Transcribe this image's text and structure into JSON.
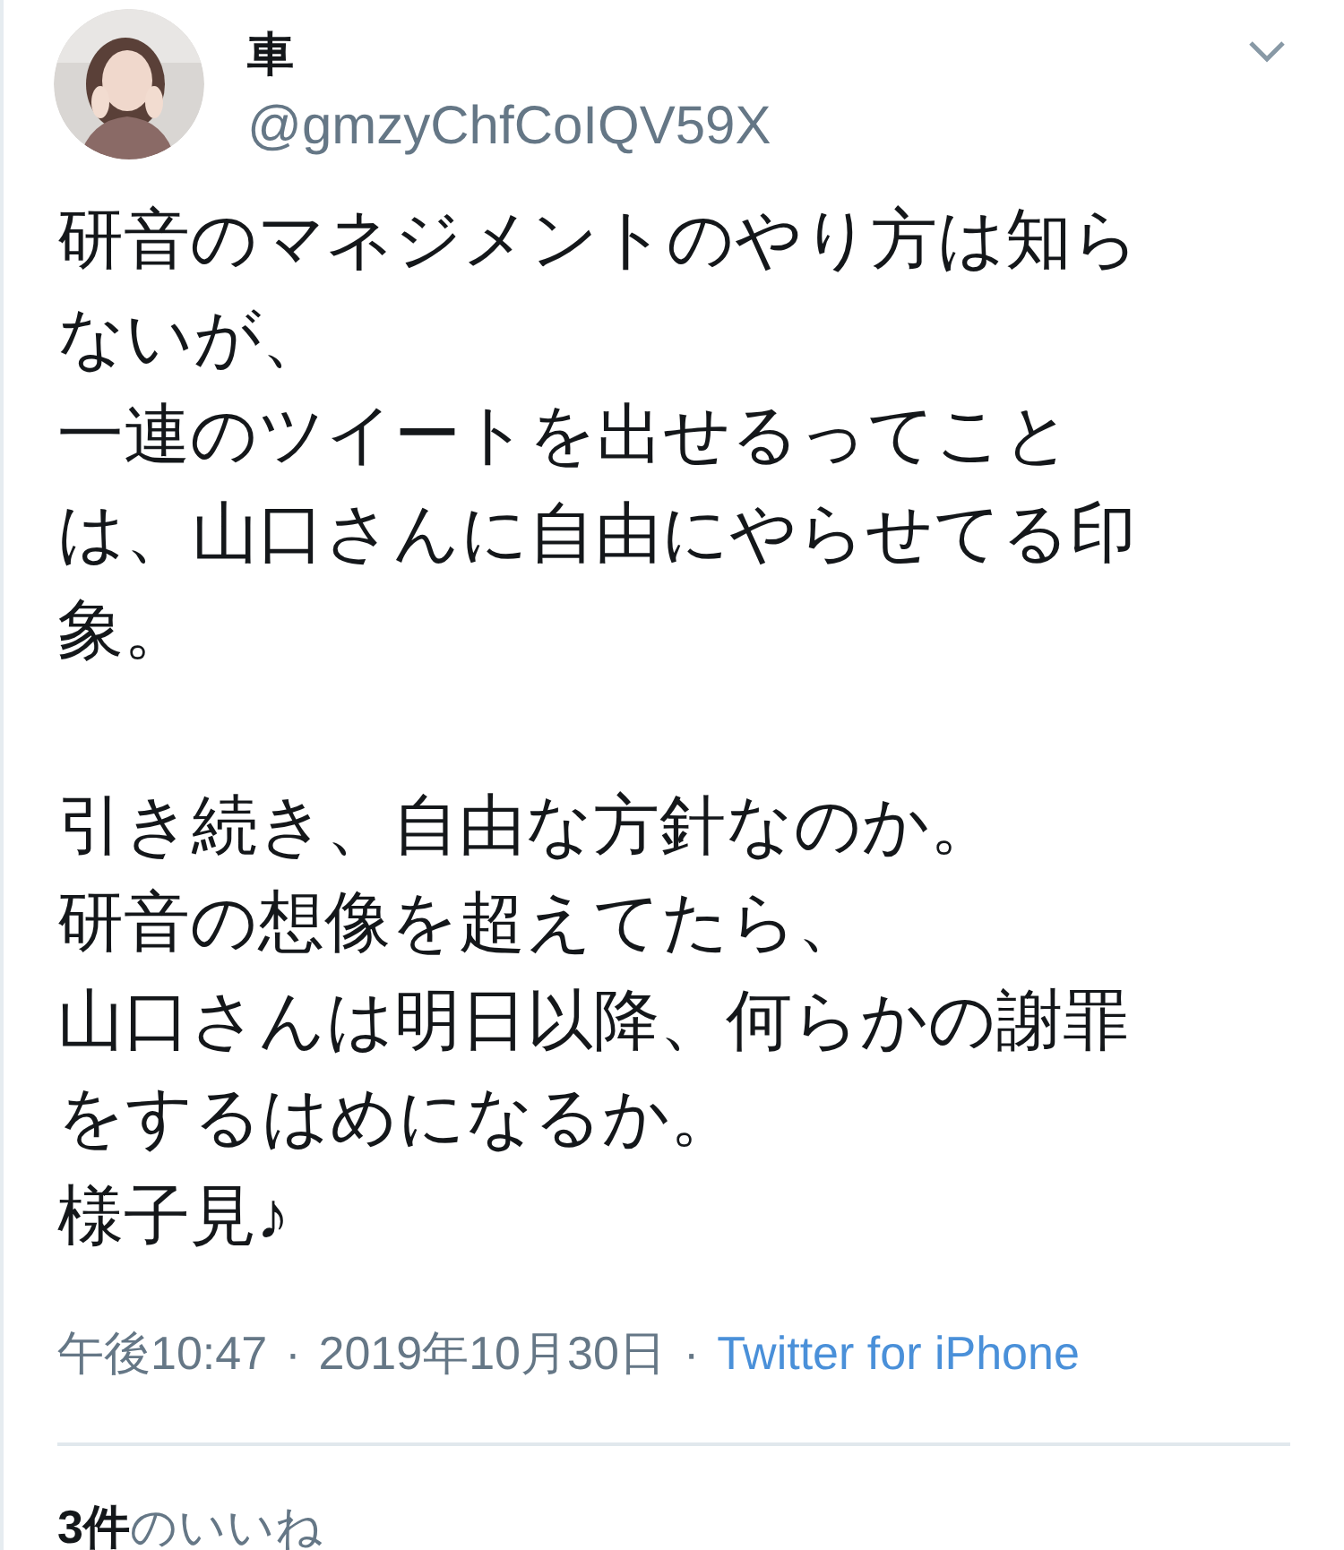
{
  "author": {
    "name": "車",
    "handle": "@gmzyChfCoIQV59X"
  },
  "body": [
    [
      "研音のマネジメントのやり方は知ら",
      "ないが、",
      "一連のツイートを出せるってこと",
      "は、山口さんに自由にやらせてる印",
      "象。"
    ],
    [
      "引き続き、自由な方針なのか。",
      "研音の想像を超えてたら、",
      "山口さんは明日以降、何らかの謝罪",
      "をするはめになるか。",
      "様子見♪"
    ]
  ],
  "meta": {
    "time": "午後10:47",
    "separator_1": "·",
    "date": "2019年10月30日",
    "separator_2": "·",
    "source": "Twitter for iPhone"
  },
  "likes": {
    "count": "3件",
    "label": "のいいね"
  }
}
